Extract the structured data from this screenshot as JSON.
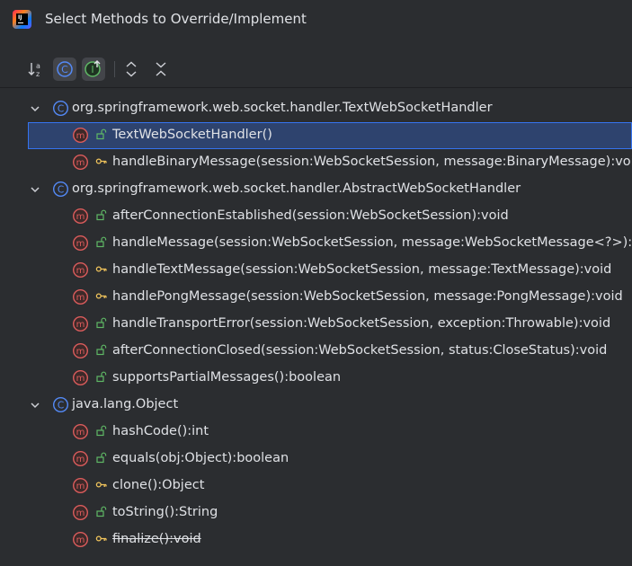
{
  "window": {
    "title": "Select Methods to Override/Implement"
  },
  "toolbar": {
    "sort_alpha_icon": "sort-alphabetically-icon",
    "group_by_class_icon": "class-icon",
    "show_interfaces_icon": "interface-implement-icon",
    "expand_all_icon": "expand-all-icon",
    "collapse_all_icon": "collapse-all-icon"
  },
  "tree": {
    "groups": [
      {
        "class_name": "org.springframework.web.socket.handler.TextWebSocketHandler",
        "methods": [
          {
            "label": "TextWebSocketHandler()",
            "visibility": "public",
            "selected": true,
            "deprecated": false
          },
          {
            "label": "handleBinaryMessage(session:WebSocketSession, message:BinaryMessage):void",
            "visibility": "protected",
            "selected": false,
            "deprecated": false
          }
        ]
      },
      {
        "class_name": "org.springframework.web.socket.handler.AbstractWebSocketHandler",
        "methods": [
          {
            "label": "afterConnectionEstablished(session:WebSocketSession):void",
            "visibility": "public",
            "selected": false,
            "deprecated": false
          },
          {
            "label": "handleMessage(session:WebSocketSession, message:WebSocketMessage<?>):void",
            "visibility": "public",
            "selected": false,
            "deprecated": false
          },
          {
            "label": "handleTextMessage(session:WebSocketSession, message:TextMessage):void",
            "visibility": "protected",
            "selected": false,
            "deprecated": false
          },
          {
            "label": "handlePongMessage(session:WebSocketSession, message:PongMessage):void",
            "visibility": "protected",
            "selected": false,
            "deprecated": false
          },
          {
            "label": "handleTransportError(session:WebSocketSession, exception:Throwable):void",
            "visibility": "public",
            "selected": false,
            "deprecated": false
          },
          {
            "label": "afterConnectionClosed(session:WebSocketSession, status:CloseStatus):void",
            "visibility": "public",
            "selected": false,
            "deprecated": false
          },
          {
            "label": "supportsPartialMessages():boolean",
            "visibility": "public",
            "selected": false,
            "deprecated": false
          }
        ]
      },
      {
        "class_name": "java.lang.Object",
        "methods": [
          {
            "label": "hashCode():int",
            "visibility": "public",
            "selected": false,
            "deprecated": false
          },
          {
            "label": "equals(obj:Object):boolean",
            "visibility": "public",
            "selected": false,
            "deprecated": false
          },
          {
            "label": "clone():Object",
            "visibility": "protected",
            "selected": false,
            "deprecated": false
          },
          {
            "label": "toString():String",
            "visibility": "public",
            "selected": false,
            "deprecated": false
          },
          {
            "label": "finalize():void",
            "visibility": "protected",
            "selected": false,
            "deprecated": true
          }
        ]
      }
    ]
  },
  "colors": {
    "background": "#2b2d30",
    "selection": "#2e436e",
    "selection_border": "#3574f0",
    "method_icon": "#db5c5c",
    "class_icon": "#548af7",
    "public_icon": "#5fb865",
    "protected_icon": "#f2c55c"
  }
}
